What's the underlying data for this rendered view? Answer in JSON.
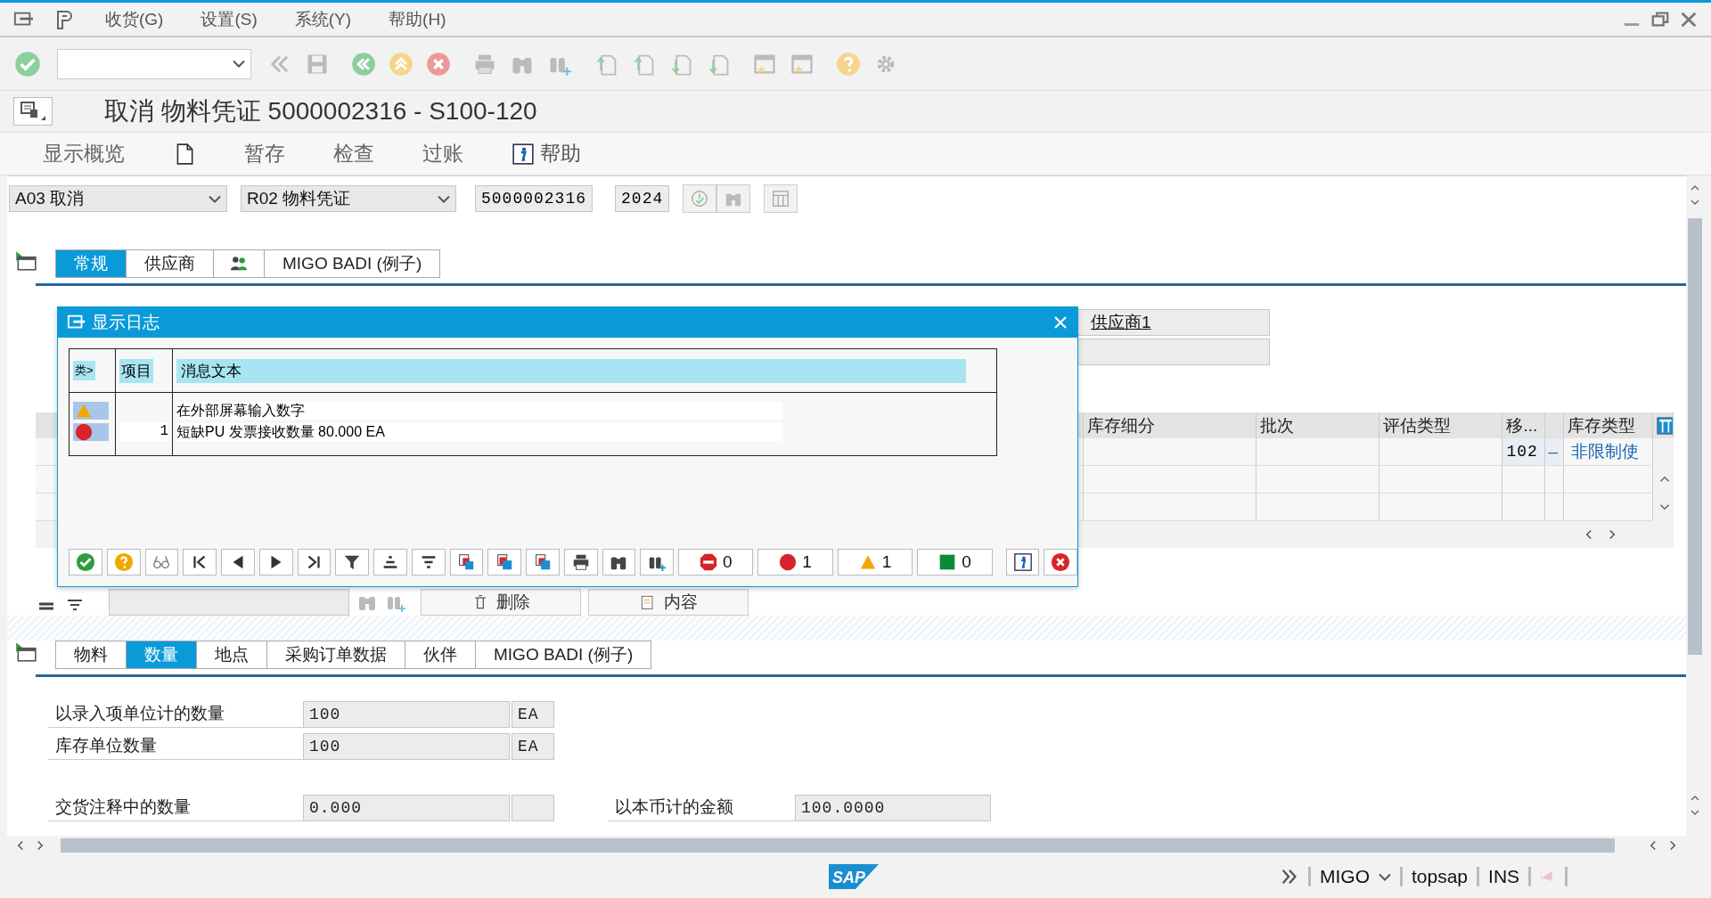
{
  "menu": {
    "items": [
      "收货(G)",
      "设置(S)",
      "系统(Y)",
      "帮助(H)"
    ]
  },
  "title": "取消 物料凭证 5000002316 - S100-120",
  "app_toolbar": [
    {
      "kind": "text",
      "label": "显示概览"
    },
    {
      "kind": "document"
    },
    {
      "kind": "text",
      "label": "暂存"
    },
    {
      "kind": "text",
      "label": "检查"
    },
    {
      "kind": "text",
      "label": "过账"
    },
    {
      "kind": "info",
      "label": "帮助"
    }
  ],
  "header": {
    "action": "A03 取消",
    "reference": "R02 物料凭证",
    "document": "5000002316",
    "year": "2024"
  },
  "header_tabs": [
    {
      "kind": "text",
      "label": "常规",
      "selected": true
    },
    {
      "kind": "text",
      "label": "供应商",
      "selected": false
    },
    {
      "kind": "people",
      "selected": false
    },
    {
      "kind": "text",
      "label": "MIGO BADI (例子)",
      "selected": false
    }
  ],
  "vendor_field": {
    "value": "供应商1"
  },
  "items_table": {
    "columns": [
      "库存细分",
      "批次",
      "评估类型",
      "移...",
      "库存类型"
    ],
    "row": {
      "movement_type": "102",
      "sign": "–",
      "stock_type": "非限制使"
    }
  },
  "lower_toolbar": {
    "buttons": [
      "删除",
      "内容"
    ]
  },
  "detail_tabs": [
    {
      "kind": "text",
      "label": "物料",
      "selected": false
    },
    {
      "kind": "text",
      "label": "数量",
      "selected": true
    },
    {
      "kind": "text",
      "label": "地点",
      "selected": false
    },
    {
      "kind": "text",
      "label": "采购订单数据",
      "selected": false
    },
    {
      "kind": "text",
      "label": "伙伴",
      "selected": false
    },
    {
      "kind": "text",
      "label": "MIGO BADI (例子)",
      "selected": false
    }
  ],
  "quantity_fields": [
    {
      "label": "以录入项单位计的数量",
      "value": "100",
      "unit": "EA"
    },
    {
      "label": "库存单位数量",
      "value": "100",
      "unit": "EA"
    },
    {
      "label": "交货注释中的数量",
      "value": "0.000"
    }
  ],
  "amount_field": {
    "label": "以本币计的金额",
    "value": "100.0000"
  },
  "dialog": {
    "title": "显示日志",
    "columns": [
      "类>",
      "项目",
      "消息文本"
    ],
    "messages": [
      {
        "kind": "warning",
        "text": "在外部屏幕输入数字"
      },
      {
        "kind": "error",
        "item": "1",
        "text": "短缺PU 发票接收数量 80.000 EA"
      }
    ],
    "counters": [
      {
        "kind": "stop",
        "count": "0"
      },
      {
        "kind": "error",
        "count": "1"
      },
      {
        "kind": "warning",
        "count": "1"
      },
      {
        "kind": "success",
        "count": "0"
      }
    ]
  },
  "status_bar": {
    "logo": "SAP",
    "transaction": "MIGO",
    "user": "topsap",
    "mode": "INS"
  }
}
